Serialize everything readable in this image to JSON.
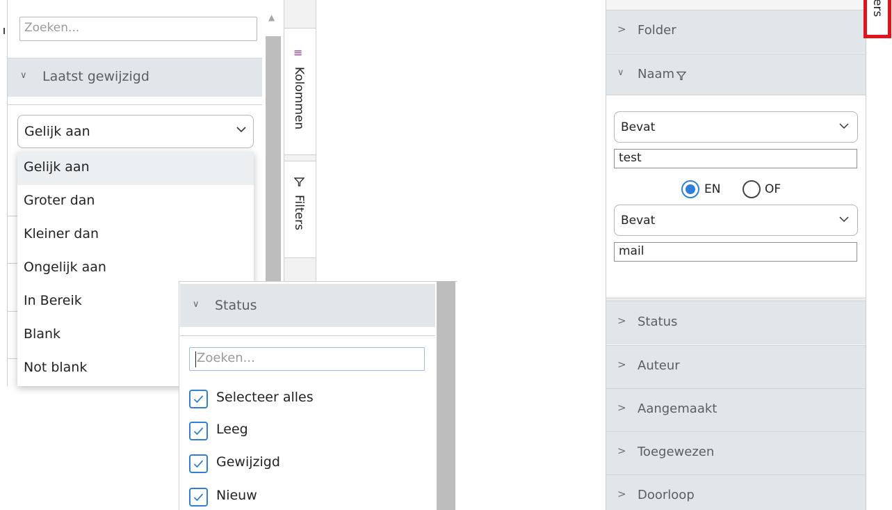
{
  "left_panel": {
    "search_placeholder": "Zoeken...",
    "section_title": "Laatst gewijzigd",
    "condition_value": "Gelijk aan",
    "options": [
      "Gelijk aan",
      "Groter dan",
      "Kleiner dan",
      "Ongelijk aan",
      "In Bereik",
      "Blank",
      "Not blank"
    ]
  },
  "side_tabs": {
    "columns_label": "Kolommen",
    "filters_label": "Filters"
  },
  "status_popup": {
    "title": "Status",
    "search_placeholder": "Zoeken...",
    "items": [
      {
        "label": "Selecteer alles",
        "checked": true
      },
      {
        "label": "Leeg",
        "checked": true
      },
      {
        "label": "Gewijzigd",
        "checked": true
      },
      {
        "label": "Nieuw",
        "checked": true
      }
    ]
  },
  "right_panel": {
    "highlighted_tab_label": "ers",
    "folder_label": "Folder",
    "name_label": "Naam",
    "condition1": "Bevat",
    "value1": "test",
    "join_and": "EN",
    "join_or": "OF",
    "join_selected": "EN",
    "condition2": "Bevat",
    "value2": "mail",
    "sections": [
      "Status",
      "Auteur",
      "Aangemaakt",
      "Toegewezen",
      "Doorloop"
    ]
  },
  "colors": {
    "accent": "#2f7fd8",
    "header_bg": "#e1e6ea",
    "highlight_red": "#e3131b",
    "columns_icon": "#8a2d8a"
  }
}
